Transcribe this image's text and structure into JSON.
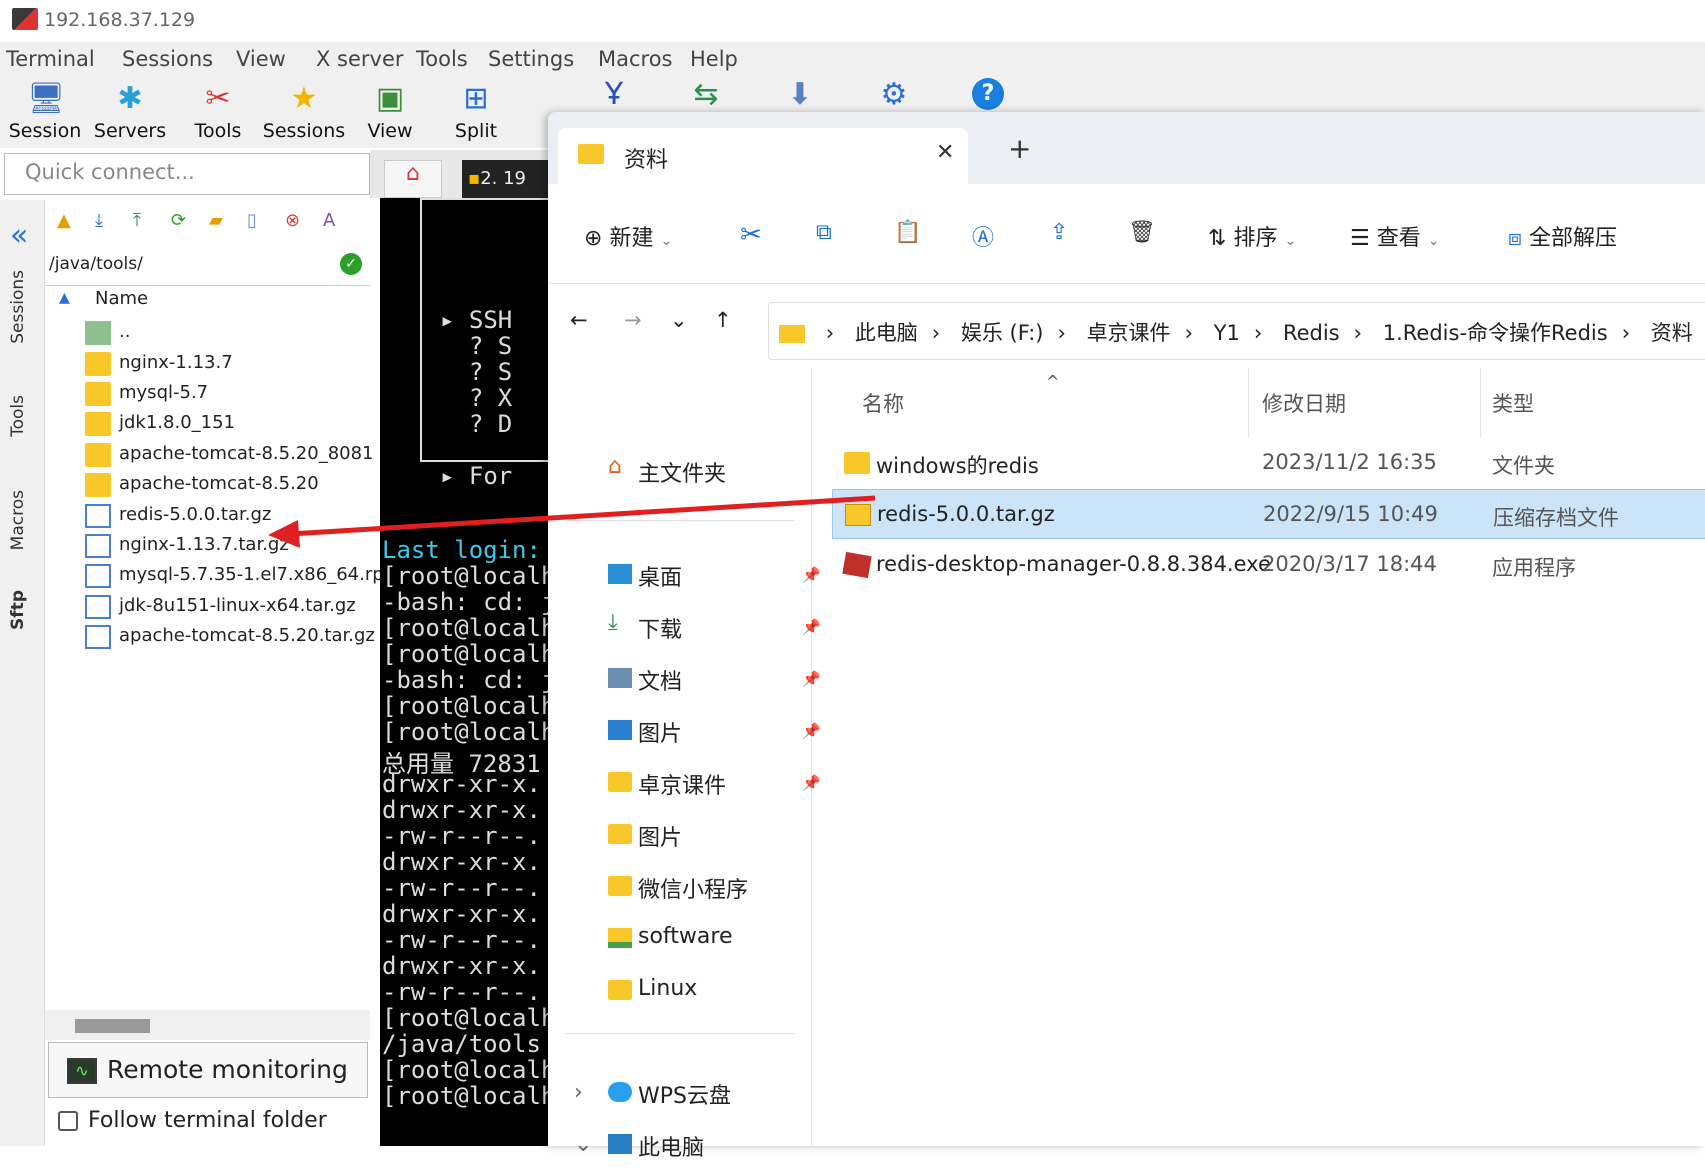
{
  "window": {
    "title": "192.168.37.129"
  },
  "menu": [
    "Terminal",
    "Sessions",
    "View",
    "X server",
    "Tools",
    "Settings",
    "Macros",
    "Help"
  ],
  "toolbar": [
    "Session",
    "Servers",
    "Tools",
    "Sessions",
    "View",
    "Split"
  ],
  "quick_connect": {
    "placeholder": "Quick connect..."
  },
  "side_tabs": [
    "Sessions",
    "Tools",
    "Macros",
    "Sftp"
  ],
  "sftp": {
    "path": "/java/tools/",
    "column": "Name",
    "items": [
      {
        "name": "..",
        "kind": "up"
      },
      {
        "name": "nginx-1.13.7",
        "kind": "folder"
      },
      {
        "name": "mysql-5.7",
        "kind": "folder"
      },
      {
        "name": "jdk1.8.0_151",
        "kind": "folder"
      },
      {
        "name": "apache-tomcat-8.5.20_8081",
        "kind": "folder"
      },
      {
        "name": "apache-tomcat-8.5.20",
        "kind": "folder"
      },
      {
        "name": "redis-5.0.0.tar.gz",
        "kind": "archive"
      },
      {
        "name": "nginx-1.13.7.tar.gz",
        "kind": "archive"
      },
      {
        "name": "mysql-5.7.35-1.el7.x86_64.rp.",
        "kind": "archive"
      },
      {
        "name": "jdk-8u151-linux-x64.tar.gz",
        "kind": "archive"
      },
      {
        "name": "apache-tomcat-8.5.20.tar.gz",
        "kind": "archive"
      }
    ],
    "remote_monitoring": "Remote monitoring",
    "follow_folder": "Follow terminal folder"
  },
  "terminal": {
    "tab_label": "2. 19",
    "lines": [
      {
        "t": "▸ SSH",
        "c": "#ddd"
      },
      {
        "t": "  ? S",
        "c": "#ddd"
      },
      {
        "t": "  ? S",
        "c": "#ddd"
      },
      {
        "t": "  ? X",
        "c": "#ddd"
      },
      {
        "t": "  ? D",
        "c": "#ddd"
      },
      {
        "t": "▸ For",
        "c": "#ddd"
      },
      {
        "t": "Last login:",
        "c": "#3fc8e8"
      },
      {
        "t": "[root@localh",
        "c": "#ddd"
      },
      {
        "t": "-bash: cd: j",
        "c": "#ddd"
      },
      {
        "t": "[root@localh",
        "c": "#ddd"
      },
      {
        "t": "[root@localh",
        "c": "#ddd"
      },
      {
        "t": "-bash: cd: j",
        "c": "#ddd"
      },
      {
        "t": "[root@localh",
        "c": "#ddd"
      },
      {
        "t": "[root@localh",
        "c": "#ddd"
      },
      {
        "t": "总用量 72831",
        "c": "#ddd"
      },
      {
        "t": "drwxr-xr-x.",
        "c": "#ddd"
      },
      {
        "t": "drwxr-xr-x.",
        "c": "#ddd"
      },
      {
        "t": "-rw-r--r--.",
        "c": "#ddd"
      },
      {
        "t": "drwxr-xr-x.",
        "c": "#ddd"
      },
      {
        "t": "-rw-r--r--.",
        "c": "#ddd"
      },
      {
        "t": "drwxr-xr-x.",
        "c": "#ddd"
      },
      {
        "t": "-rw-r--r--.",
        "c": "#ddd"
      },
      {
        "t": "drwxr-xr-x.",
        "c": "#ddd"
      },
      {
        "t": "-rw-r--r--.",
        "c": "#ddd"
      },
      {
        "t": "[root@localh",
        "c": "#ddd"
      },
      {
        "t": "/java/tools",
        "c": "#ddd"
      },
      {
        "t": "[root@localh",
        "c": "#ddd"
      },
      {
        "t": "[root@localh",
        "c": "#ddd"
      }
    ]
  },
  "explorer": {
    "tab_title": "资料",
    "commands": {
      "new": "新建",
      "sort": "排序",
      "view": "查看",
      "extract": "全部解压"
    },
    "breadcrumb": [
      "此电脑",
      "娱乐 (F:)",
      "卓京课件",
      "Y1",
      "Redis",
      "1.Redis-命令操作Redis",
      "资料"
    ],
    "nav": [
      {
        "label": "主文件夹",
        "icon": "home-icon",
        "pinned": false
      },
      {
        "label": "桌面",
        "icon": "desktop-icon",
        "pinned": true
      },
      {
        "label": "下载",
        "icon": "download-icon",
        "pinned": true
      },
      {
        "label": "文档",
        "icon": "document-icon",
        "pinned": true
      },
      {
        "label": "图片",
        "icon": "picture-icon",
        "pinned": true
      },
      {
        "label": "卓京课件",
        "icon": "folder-icon",
        "pinned": true
      },
      {
        "label": "图片",
        "icon": "folder-icon",
        "pinned": false
      },
      {
        "label": "微信小程序",
        "icon": "folder-icon",
        "pinned": false
      },
      {
        "label": "software",
        "icon": "folder-icon",
        "pinned": false
      },
      {
        "label": "Linux",
        "icon": "folder-icon",
        "pinned": false
      },
      {
        "label": "WPS云盘",
        "icon": "cloud-icon",
        "pinned": false
      },
      {
        "label": "此电脑",
        "icon": "computer-icon",
        "pinned": false
      }
    ],
    "columns": {
      "name": "名称",
      "modified": "修改日期",
      "type": "类型"
    },
    "files": [
      {
        "name": "windows的redis",
        "modified": "2023/11/2 16:35",
        "type": "文件夹",
        "icon": "folder-icon",
        "selected": false
      },
      {
        "name": "redis-5.0.0.tar.gz",
        "modified": "2022/9/15 10:49",
        "type": "压缩存档文件",
        "icon": "archive-icon",
        "selected": true
      },
      {
        "name": "redis-desktop-manager-0.8.8.384.exe",
        "modified": "2020/3/17 18:44",
        "type": "应用程序",
        "icon": "exe-icon",
        "selected": false
      }
    ]
  },
  "colors": {
    "accent": "#1a6fd1",
    "arrow": "#e02020",
    "selection": "#cce4f7",
    "terminal_bg": "#000000"
  }
}
